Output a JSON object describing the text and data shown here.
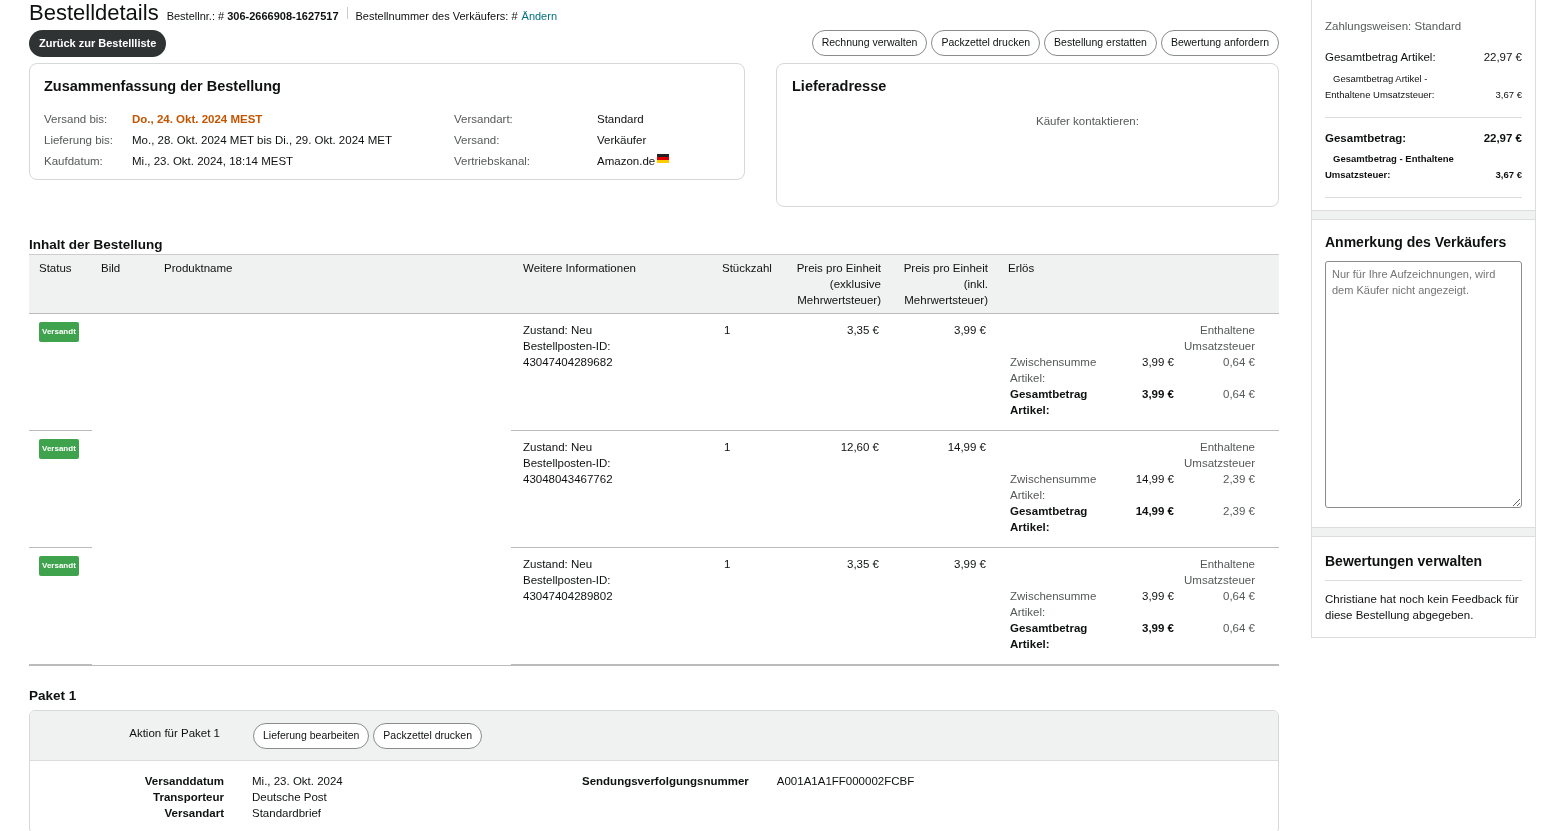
{
  "header": {
    "title": "Bestelldetails",
    "order_label": "Bestellnr.: #",
    "order_number": "306-2666908-1627517",
    "seller_order_label": "Bestellnummer des Verkäufers: #",
    "change_link": "Ändern"
  },
  "back_button": "Zurück zur Bestellliste",
  "actions": [
    "Rechnung verwalten",
    "Packzettel drucken",
    "Bestellung erstatten",
    "Bewertung anfordern"
  ],
  "summary": {
    "title": "Zusammenfassung der Bestellung",
    "left": [
      {
        "label": "Versand bis:",
        "value": "Do., 24. Okt. 2024 MEST",
        "highlight": true
      },
      {
        "label": "Lieferung bis:",
        "value": "Mo., 28. Okt. 2024 MET bis Di., 29. Okt. 2024 MET",
        "highlight": false
      },
      {
        "label": "Kaufdatum:",
        "value": "Mi., 23. Okt. 2024, 18:14 MEST",
        "highlight": false
      }
    ],
    "right": [
      {
        "label": "Versandart:",
        "value": "Standard",
        "kind": "text"
      },
      {
        "label": "Versand:",
        "value": "Verkäufer",
        "kind": "text"
      },
      {
        "label": "Vertriebskanal:",
        "value": "Amazon.de",
        "kind": "flag"
      }
    ]
  },
  "delivery_address": {
    "title": "Lieferadresse",
    "contact_label": "Käufer kontaktieren:"
  },
  "contents": {
    "title": "Inhalt der Bestellung",
    "columns": [
      "Status",
      "Bild",
      "Produktname",
      "Weitere Informationen",
      "Stückzahl",
      "Preis pro Einheit (exklusive Mehrwertsteuer)",
      "Preis pro Einheit (inkl. Mehrwertsteuer)",
      "Erlös"
    ],
    "rows": [
      {
        "status": "Versandt",
        "condition": "Zustand: Neu",
        "item_id_label": "Bestellposten-ID:",
        "item_id": "43047404289682",
        "quantity": "1",
        "price_excl": "3,35 €",
        "price_incl": "3,99 €",
        "tax_heading": "Enthaltene Umsatzsteuer",
        "subtotal_label": "Zwischensumme Artikel:",
        "subtotal": "3,99 €",
        "subtotal_tax": "0,64 €",
        "total_label": "Gesamtbetrag Artikel:",
        "total": "3,99 €",
        "total_tax": "0,64 €"
      },
      {
        "status": "Versandt",
        "condition": "Zustand: Neu",
        "item_id_label": "Bestellposten-ID:",
        "item_id": "43048043467762",
        "quantity": "1",
        "price_excl": "12,60 €",
        "price_incl": "14,99 €",
        "tax_heading": "Enthaltene Umsatzsteuer",
        "subtotal_label": "Zwischensumme Artikel:",
        "subtotal": "14,99 €",
        "subtotal_tax": "2,39 €",
        "total_label": "Gesamtbetrag Artikel:",
        "total": "14,99 €",
        "total_tax": "2,39 €"
      },
      {
        "status": "Versandt",
        "condition": "Zustand: Neu",
        "item_id_label": "Bestellposten-ID:",
        "item_id": "43047404289802",
        "quantity": "1",
        "price_excl": "3,35 €",
        "price_incl": "3,99 €",
        "tax_heading": "Enthaltene Umsatzsteuer",
        "subtotal_label": "Zwischensumme Artikel:",
        "subtotal": "3,99 €",
        "subtotal_tax": "0,64 €",
        "total_label": "Gesamtbetrag Artikel:",
        "total": "3,99 €",
        "total_tax": "0,64 €"
      }
    ]
  },
  "package": {
    "title": "Paket 1",
    "action_label": "Aktion für Paket 1",
    "buttons": [
      "Lieferung bearbeiten",
      "Packzettel drucken"
    ],
    "details": [
      {
        "label": "Versanddatum",
        "value": "Mi., 23. Okt. 2024"
      },
      {
        "label": "Transporteur",
        "value": "Deutsche Post"
      },
      {
        "label": "Versandart",
        "value": "Standardbrief"
      }
    ],
    "tracking_label": "Sendungsverfolgungsnummer",
    "tracking_number": "A001A1A1FF000002FCBF"
  },
  "sidebar": {
    "payment_method": "Zahlungsweisen: Standard",
    "groups": [
      {
        "bold": false,
        "lines": [
          {
            "label": "Gesamtbetrag Artikel:",
            "value": "22,97 €",
            "kind": "main"
          },
          {
            "label": "Gesamtbetrag Artikel - Enthaltene Umsatzsteuer:",
            "value": "3,67 €",
            "kind": "sub"
          }
        ]
      },
      {
        "bold": true,
        "lines": [
          {
            "label": "Gesamtbetrag:",
            "value": "22,97 €",
            "kind": "main"
          },
          {
            "label": "Gesamtbetrag - Enthaltene Umsatzsteuer:",
            "value": "3,67 €",
            "kind": "sub"
          }
        ]
      }
    ],
    "note": {
      "title": "Anmerkung des Verkäufers",
      "placeholder": "Nur für Ihre Aufzeichnungen, wird dem Käufer nicht angezeigt."
    },
    "reviews": {
      "title": "Bewertungen verwalten",
      "text": "Christiane hat noch kein Feedback für diese Bestellung abgegeben."
    }
  }
}
